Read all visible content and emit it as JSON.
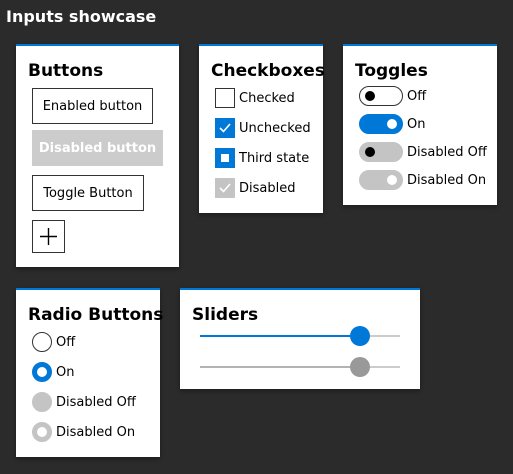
{
  "page_title": "Inputs showcase",
  "colors": {
    "accent": "#0078d7",
    "background": "#2b2b2b",
    "disabled": "#cccccc"
  },
  "buttons": {
    "title": "Buttons",
    "enabled_label": "Enabled button",
    "disabled_label": "Disabled button",
    "toggle_label": "Toggle Button",
    "add_icon": "plus-icon"
  },
  "checkboxes": {
    "title": "Checkboxes",
    "items": [
      {
        "label": "Checked",
        "state": "unchecked"
      },
      {
        "label": "Unchecked",
        "state": "checked"
      },
      {
        "label": "Third state",
        "state": "indeterminate"
      },
      {
        "label": "Disabled",
        "state": "disabled-checked"
      }
    ]
  },
  "toggles": {
    "title": "Toggles",
    "items": [
      {
        "label": "Off",
        "state": "off"
      },
      {
        "label": "On",
        "state": "on"
      },
      {
        "label": "Disabled Off",
        "state": "disabled-off"
      },
      {
        "label": "Disabled On",
        "state": "disabled-on"
      }
    ]
  },
  "radio_buttons": {
    "title": "Radio Buttons",
    "items": [
      {
        "label": "Off",
        "state": "off"
      },
      {
        "label": "On",
        "state": "on"
      },
      {
        "label": "Disabled Off",
        "state": "disabled-off"
      },
      {
        "label": "Disabled On",
        "state": "disabled-on"
      }
    ]
  },
  "sliders": {
    "title": "Sliders",
    "items": [
      {
        "value": 0.8,
        "disabled": false
      },
      {
        "value": 0.8,
        "disabled": true
      }
    ]
  }
}
